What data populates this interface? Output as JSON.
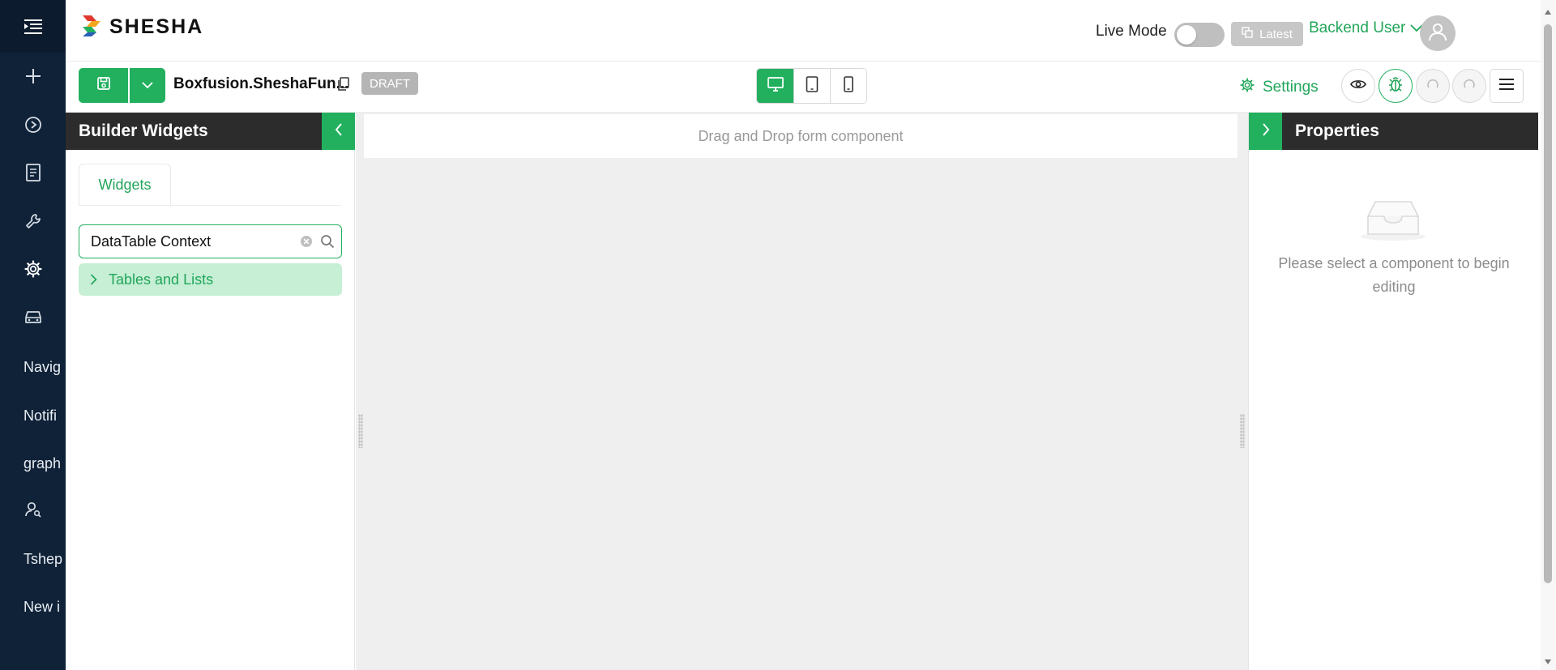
{
  "sidebar": {
    "menu_icon": "menu-fold-icon",
    "icon_items": [
      {
        "icon": "plus-icon"
      },
      {
        "icon": "play-circle-icon"
      },
      {
        "icon": "document-icon"
      },
      {
        "icon": "wrench-icon"
      },
      {
        "icon": "gear-icon"
      },
      {
        "icon": "car-icon"
      }
    ],
    "text_items": [
      {
        "label": "Navig"
      },
      {
        "label": "Notifi"
      },
      {
        "label": "graph"
      }
    ],
    "user_item_icon": "user-search-icon",
    "text_items_2": [
      {
        "label": "Tshep"
      },
      {
        "label": "New i"
      }
    ]
  },
  "header": {
    "logo_text": "SHESHA",
    "live_mode_label": "Live Mode",
    "live_mode_on": false,
    "latest_label": "Latest",
    "user_name": "Backend User"
  },
  "toolbar": {
    "form_name": "Boxfusion.SheshaFun...",
    "status_badge": "DRAFT",
    "active_device": "desktop",
    "settings_label": "Settings"
  },
  "widgets_panel": {
    "title": "Builder Widgets",
    "tab_label": "Widgets",
    "search_value": "DataTable Context",
    "groups": [
      {
        "label": "Tables and Lists"
      }
    ]
  },
  "canvas": {
    "drop_hint": "Drag and Drop form component"
  },
  "properties_panel": {
    "title": "Properties",
    "empty_text": "Please select a component to begin editing"
  },
  "colors": {
    "brand_green": "#22b05f",
    "sidebar_bg": "#0f2238",
    "panel_header_bg": "#2c2c2c"
  }
}
